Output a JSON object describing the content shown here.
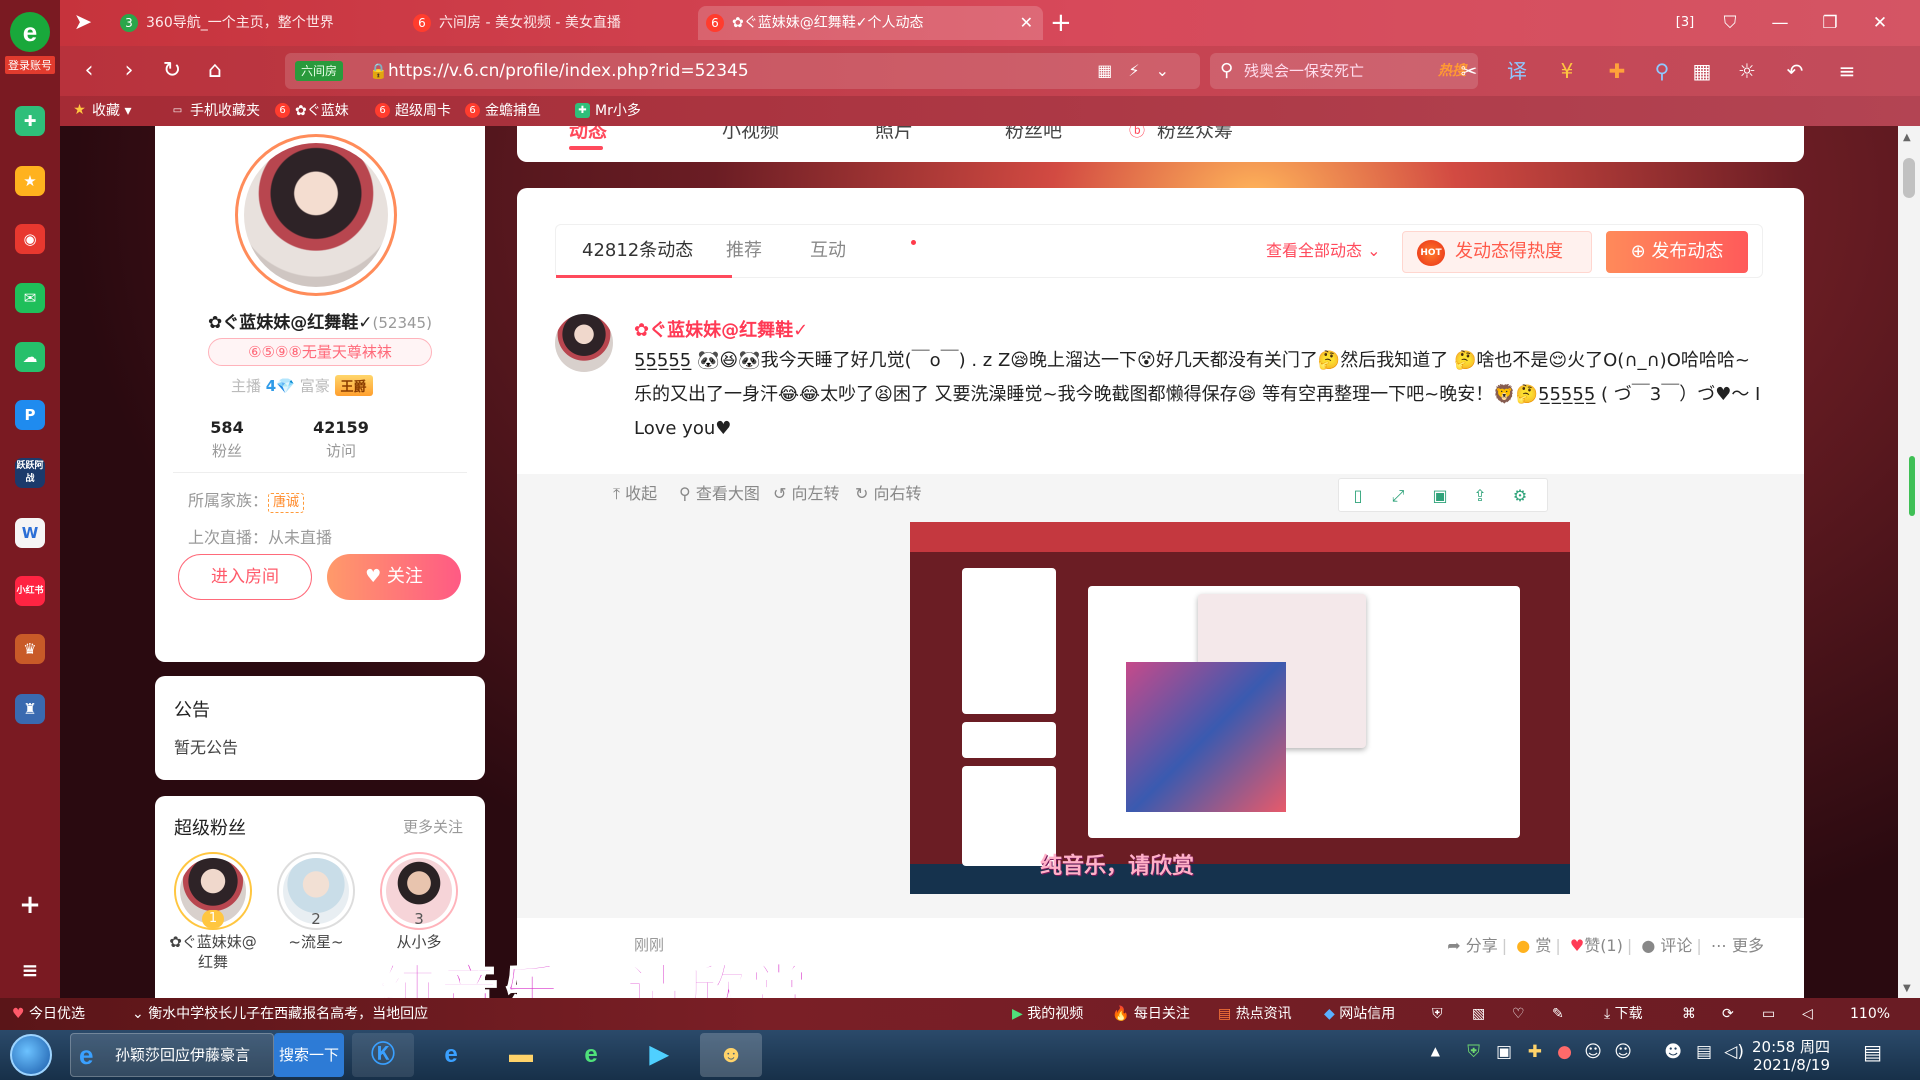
{
  "sidebar": {
    "login_label": "登录账号",
    "icons": [
      "plus-square-icon",
      "star-icon",
      "weibo-icon",
      "mail-icon",
      "cloud-icon",
      "p-app-icon",
      "game-icon",
      "doc-icon",
      "xiaohongshu-icon",
      "game-character-icon",
      "game2-icon",
      "add-icon",
      "list-icon"
    ],
    "game_label": "跃跃阿战",
    "xhs_label": "小红书"
  },
  "tabs": [
    {
      "title": "360导航_一个主页，整个世界",
      "icon": "360-icon"
    },
    {
      "title": "六间房 - 美女视频 - 美女直播",
      "icon": "six-icon"
    },
    {
      "title": "✿ぐ蓝妹妹@红舞鞋✓个人动态",
      "icon": "six-icon"
    }
  ],
  "window": {
    "tab_count": "3"
  },
  "address": {
    "badge": "六间房",
    "url": "https://v.6.cn/profile/index.php?rid=52345"
  },
  "search": {
    "text": "残奥会一保安死亡",
    "hot": "热搜"
  },
  "bookmarks": [
    "收藏",
    "手机收藏夹",
    "✿ぐ蓝妹",
    "超级周卡",
    "金蟾捕鱼",
    "Mr小多"
  ],
  "topnav": {
    "items": [
      "动态",
      "小视频",
      "照片",
      "粉丝吧",
      "粉丝众筹"
    ]
  },
  "profile": {
    "nickname": "✿ぐ蓝妹妹@红舞鞋✓",
    "rid": "(52345)",
    "medal": "⑥⑤⑨⑧无量天尊袜袜",
    "anchor_label": "主播",
    "anchor_level": "4",
    "rich_label": "富豪",
    "rich_badge": "王爵",
    "fans_count": "584",
    "fans_label": "粉丝",
    "visits_count": "42159",
    "visits_label": "访问",
    "family_label": "所属家族：",
    "family_name": "唐诚",
    "last_live": "上次直播：从未直播",
    "enter_room": "进入房间",
    "follow": "关注"
  },
  "notice": {
    "title": "公告",
    "body": "暂无公告"
  },
  "super_fans": {
    "title": "超级粉丝",
    "more": "更多关注",
    "fans": [
      {
        "rank": "1",
        "name": "✿ぐ蓝妹妹@红舞"
      },
      {
        "rank": "2",
        "name": "~流星~"
      },
      {
        "rank": "3",
        "name": "从小多"
      }
    ]
  },
  "feed": {
    "tabs": [
      {
        "label": "42812条动态"
      },
      {
        "label": "推荐"
      },
      {
        "label": "互动"
      }
    ],
    "view_all": "查看全部动态",
    "heat_button": "发动态得热度",
    "hot_icon": "HOT",
    "post_button": "发布动态"
  },
  "post": {
    "author": "✿ぐ蓝妹妹@红舞鞋✓",
    "text": "5̲5̲5̲5̲5̲ 🐼😆🐼我今天睡了好几觉(￣o￣) . z Z😪晚上溜达一下😵好几天都没有关门了🤔然后我知道了 🤔啥也不是😌火了O(∩_∩)O哈哈哈~乐的又出了一身汗😂😂太吵了😫困了 又要洗澡睡觉~我今晚截图都懒得保存😪 等有空再整理一下吧~晚安！🦁🤔5̲5̲5̲5̲5̲ ( づ￣3￣）づ♥～ I Love you♥",
    "tools": {
      "collapse": "收起",
      "view_big": "查看大图",
      "rotate_left": "向左转",
      "rotate_right": "向右转"
    },
    "time": "刚刚",
    "actions": {
      "share": "分享",
      "reward": "赏",
      "like": "赞(1)",
      "comment": "评论",
      "more": "更多"
    }
  },
  "screenshot": {
    "caption": "纯音乐，请欣赏"
  },
  "overlay_caption": "纯音乐，请欣赏",
  "statusbar": {
    "today": "今日优选",
    "news": "衡水中学校长儿子在西藏报名高考，当地回应",
    "my_video": "我的视频",
    "daily": "每日关注",
    "hot_news": "热点资讯",
    "site_credit": "网站信用",
    "download": "下载",
    "zoom": "110%"
  },
  "taskbar": {
    "ie_task": "孙颖莎回应伊藤豪言",
    "search": "搜索一下",
    "time": "20:58 周四",
    "date": "2021/8/19"
  },
  "colors": {
    "accent": "#ff4a5c",
    "chrome": "#c6333c"
  }
}
